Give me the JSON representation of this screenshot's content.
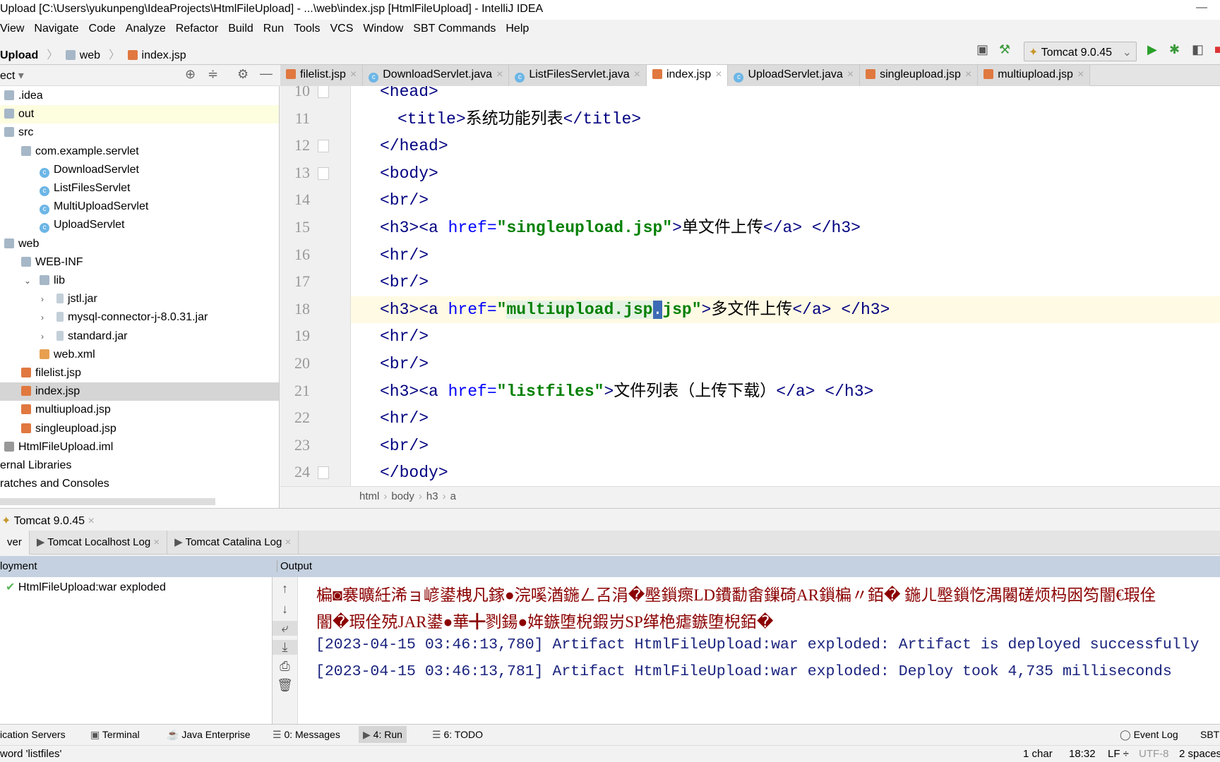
{
  "window": {
    "title": "Upload [C:\\Users\\yukunpeng\\IdeaProjects\\HtmlFileUpload] - ...\\web\\index.jsp [HtmlFileUpload] - IntelliJ IDEA",
    "controls": "—"
  },
  "menu": [
    "View",
    "Navigate",
    "Code",
    "Analyze",
    "Refactor",
    "Build",
    "Run",
    "Tools",
    "VCS",
    "Window",
    "SBT Commands",
    "Help"
  ],
  "nav": {
    "crumbs": [
      "Upload",
      "web",
      "index.jsp"
    ],
    "run_config": "Tomcat 9.0.45"
  },
  "project": {
    "header": "ect",
    "tree": [
      {
        "label": ".idea",
        "level": 0,
        "icon": "folder"
      },
      {
        "label": "out",
        "level": 0,
        "icon": "folder",
        "state": "highlighted"
      },
      {
        "label": "src",
        "level": 0,
        "icon": "folder"
      },
      {
        "label": "com.example.servlet",
        "level": 1,
        "icon": "folder"
      },
      {
        "label": "DownloadServlet",
        "level": 2,
        "icon": "class"
      },
      {
        "label": "ListFilesServlet",
        "level": 2,
        "icon": "class"
      },
      {
        "label": "MultiUploadServlet",
        "level": 2,
        "icon": "class"
      },
      {
        "label": "UploadServlet",
        "level": 2,
        "icon": "class"
      },
      {
        "label": "web",
        "level": 0,
        "icon": "folder"
      },
      {
        "label": "WEB-INF",
        "level": 1,
        "icon": "folder"
      },
      {
        "label": "lib",
        "level": 2,
        "icon": "folder",
        "arrow": "expanded"
      },
      {
        "label": "jstl.jar",
        "level": 3,
        "icon": "jar",
        "arrow": "collapsed"
      },
      {
        "label": "mysql-connector-j-8.0.31.jar",
        "level": 3,
        "icon": "jar",
        "arrow": "collapsed"
      },
      {
        "label": "standard.jar",
        "level": 3,
        "icon": "jar",
        "arrow": "collapsed"
      },
      {
        "label": "web.xml",
        "level": 2,
        "icon": "xml"
      },
      {
        "label": "filelist.jsp",
        "level": 1,
        "icon": "jsp"
      },
      {
        "label": "index.jsp",
        "level": 1,
        "icon": "jsp",
        "state": "selected"
      },
      {
        "label": "multiupload.jsp",
        "level": 1,
        "icon": "jsp"
      },
      {
        "label": "singleupload.jsp",
        "level": 1,
        "icon": "jsp"
      },
      {
        "label": "HtmlFileUpload.iml",
        "level": 0,
        "icon": "iml"
      },
      {
        "label": "ernal Libraries",
        "level": -1,
        "icon": ""
      },
      {
        "label": "ratches and Consoles",
        "level": -1,
        "icon": ""
      }
    ]
  },
  "editor_tabs": [
    {
      "label": "filelist.jsp",
      "icon": "jsp"
    },
    {
      "label": "DownloadServlet.java",
      "icon": "class"
    },
    {
      "label": "ListFilesServlet.java",
      "icon": "class"
    },
    {
      "label": "index.jsp",
      "icon": "jsp",
      "active": true
    },
    {
      "label": "UploadServlet.java",
      "icon": "class"
    },
    {
      "label": "singleupload.jsp",
      "icon": "jsp"
    },
    {
      "label": "multiupload.jsp",
      "icon": "jsp"
    }
  ],
  "code": [
    {
      "n": "10",
      "tokens": [
        [
          "tag",
          "<head>"
        ]
      ],
      "indent": 0
    },
    {
      "n": "11",
      "tokens": [
        [
          "tag",
          "<title>"
        ],
        [
          "txt",
          "系统功能列表"
        ],
        [
          "tag",
          "</title>"
        ]
      ],
      "indent": 1
    },
    {
      "n": "12",
      "tokens": [
        [
          "tag",
          "</head>"
        ]
      ],
      "indent": 0
    },
    {
      "n": "13",
      "tokens": [
        [
          "tag",
          "<body>"
        ]
      ],
      "indent": 0
    },
    {
      "n": "14",
      "tokens": [
        [
          "tag",
          "<br/>"
        ]
      ],
      "indent": 0
    },
    {
      "n": "15",
      "tokens": [
        [
          "tag",
          "<h3><a "
        ],
        [
          "attr",
          "href="
        ],
        [
          "val",
          "\"singleupload.jsp\""
        ],
        [
          "tag",
          ">"
        ],
        [
          "txt",
          "单文件上传"
        ],
        [
          "tag",
          "</a> </h3>"
        ]
      ],
      "indent": 0
    },
    {
      "n": "16",
      "tokens": [
        [
          "tag",
          "<hr/>"
        ]
      ],
      "indent": 0
    },
    {
      "n": "17",
      "tokens": [
        [
          "tag",
          "<br/>"
        ]
      ],
      "indent": 0
    },
    {
      "n": "18",
      "tokens": [
        [
          "tag",
          "<h3><a "
        ],
        [
          "attr",
          "href="
        ],
        [
          "val",
          "\""
        ],
        [
          "valhl",
          "multiupload.jsp"
        ],
        [
          "sel",
          "."
        ],
        [
          "val",
          "jsp\""
        ],
        [
          "tag",
          ">"
        ],
        [
          "txt",
          "多文件上传"
        ],
        [
          "tag",
          "</a> </h3>"
        ]
      ],
      "indent": 0,
      "current": true
    },
    {
      "n": "19",
      "tokens": [
        [
          "tag",
          "<hr/>"
        ]
      ],
      "indent": 0
    },
    {
      "n": "20",
      "tokens": [
        [
          "tag",
          "<br/>"
        ]
      ],
      "indent": 0
    },
    {
      "n": "21",
      "tokens": [
        [
          "tag",
          "<h3><a "
        ],
        [
          "attr",
          "href="
        ],
        [
          "val",
          "\"listfiles\""
        ],
        [
          "tag",
          ">"
        ],
        [
          "txt",
          "文件列表（上传下载）"
        ],
        [
          "tag",
          "</a> </h3>"
        ]
      ],
      "indent": 0
    },
    {
      "n": "22",
      "tokens": [
        [
          "tag",
          "<hr/>"
        ]
      ],
      "indent": 0
    },
    {
      "n": "23",
      "tokens": [
        [
          "tag",
          "<br/>"
        ]
      ],
      "indent": 0
    },
    {
      "n": "24",
      "tokens": [
        [
          "tag",
          "</body>"
        ]
      ],
      "indent": 0
    }
  ],
  "browsers": [
    {
      "name": "chrome-icon",
      "color": "#e8a93a"
    },
    {
      "name": "firefox-icon",
      "color": "#e66a2c"
    },
    {
      "name": "safari-icon",
      "color": "#2f8ee0"
    },
    {
      "name": "opera-icon",
      "color": "#d8262b"
    },
    {
      "name": "ie-icon",
      "color": "#8fd0f0"
    },
    {
      "name": "edge-icon",
      "color": "#1f72c8"
    }
  ],
  "breadcrumb": [
    "html",
    "body",
    "h3",
    "a"
  ],
  "run": {
    "title": "Tomcat 9.0.45",
    "subtabs": [
      "ver",
      "Tomcat Localhost Log",
      "Tomcat Catalina Log"
    ],
    "col_deployment": "loyment",
    "col_output": "Output",
    "deployment_item": "HtmlFileUpload:war exploded",
    "output": [
      {
        "text": "楄◙褰曠紝浠ョ嵃鍙栧凡鎵●浣嗘湭鍦ㄥ叾涓�壂鎻瘝LD鐨勫畬鏁碕AR鎻楄〃銆� 鍦ㄦ壂鎻忔湡闂磋烦杩囦笉闇€瑕佺",
        "kind": "err"
      },
      {
        "text": "闇�瑕佺殑JAR鍙●華╋剹鍚●姩鏃堕棿鍜岃SP缂栬瘧鏃堕棿銆�",
        "kind": "err"
      },
      {
        "text": "[2023-04-15 03:46:13,780] Artifact HtmlFileUpload:war exploded: Artifact is deployed successfully",
        "kind": "log"
      },
      {
        "text": "[2023-04-15 03:46:13,781] Artifact HtmlFileUpload:war exploded: Deploy took 4,735 milliseconds",
        "kind": "log"
      }
    ]
  },
  "toolwindows": [
    "ication Servers",
    "Terminal",
    "Java Enterprise",
    "0: Messages",
    "4: Run",
    "6: TODO",
    "Event Log",
    "SBT"
  ],
  "status": {
    "message": "word 'listfiles'",
    "selection": "1 char",
    "position": "18:32",
    "line_sep": "LF ÷",
    "encoding": "UTF-8",
    "indent": "2 spaces"
  }
}
